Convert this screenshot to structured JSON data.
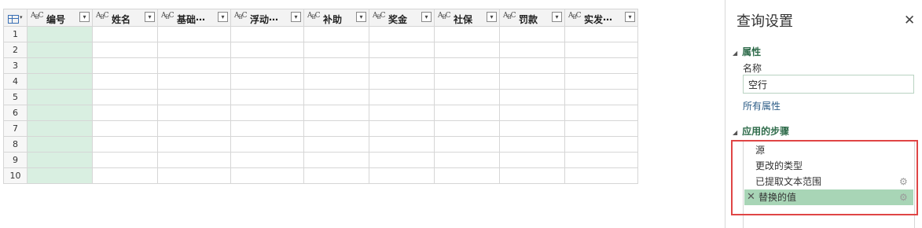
{
  "grid": {
    "columns": [
      {
        "type": "ABC",
        "label": "编号",
        "selected": true
      },
      {
        "type": "ABC",
        "label": "姓名",
        "selected": false
      },
      {
        "type": "ABC",
        "label": "基础⋯",
        "selected": false
      },
      {
        "type": "ABC",
        "label": "浮动⋯",
        "selected": false
      },
      {
        "type": "ABC",
        "label": "补助",
        "selected": false
      },
      {
        "type": "ABC",
        "label": "奖金",
        "selected": false
      },
      {
        "type": "ABC",
        "label": "社保",
        "selected": false
      },
      {
        "type": "ABC",
        "label": "罚款",
        "selected": false
      },
      {
        "type": "ABC",
        "label": "实发⋯",
        "selected": false
      }
    ],
    "rows": [
      "1",
      "2",
      "3",
      "4",
      "5",
      "6",
      "7",
      "8",
      "9",
      "10"
    ],
    "corner_icon": "table-icon",
    "dropdown_icon": "chevron-down-icon"
  },
  "pane": {
    "title": "查询设置",
    "close": "✕",
    "properties": {
      "heading": "属性",
      "name_label": "名称",
      "name_value": "空行",
      "all_properties_link": "所有属性"
    },
    "steps": {
      "heading": "应用的步骤",
      "items": [
        {
          "label": "源",
          "gear": false,
          "active": false
        },
        {
          "label": "更改的类型",
          "gear": false,
          "active": false
        },
        {
          "label": "已提取文本范围",
          "gear": true,
          "active": false
        },
        {
          "label": "替换的值",
          "gear": true,
          "active": true
        }
      ]
    }
  },
  "colors": {
    "selected_column": "#d9efe1",
    "active_step": "#a8d5b6",
    "highlight_box": "#e04545",
    "section_heading": "#2e6b4a"
  }
}
